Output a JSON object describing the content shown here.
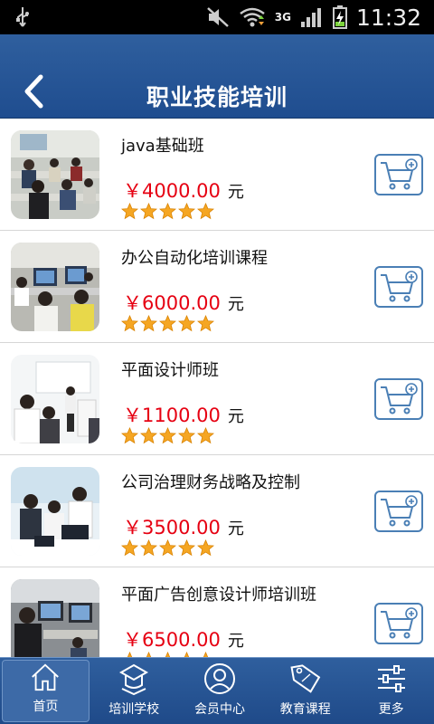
{
  "status": {
    "time": "11:32",
    "network": "3G"
  },
  "header": {
    "title": "职业技能培训"
  },
  "courses": [
    {
      "name": "java基础班",
      "price": "￥4000.00",
      "unit": "元",
      "rating": 5
    },
    {
      "name": "办公自动化培训课程",
      "price": "￥6000.00",
      "unit": "元",
      "rating": 5
    },
    {
      "name": "平面设计师班",
      "price": "￥1100.00",
      "unit": "元",
      "rating": 5
    },
    {
      "name": "公司治理财务战略及控制",
      "price": "￥3500.00",
      "unit": "元",
      "rating": 5
    },
    {
      "name": "平面广告创意设计师培训班",
      "price": "￥6500.00",
      "unit": "元",
      "rating": 5
    }
  ],
  "nav": {
    "items": [
      {
        "label": "首页",
        "icon": "home-icon",
        "active": true
      },
      {
        "label": "培训学校",
        "icon": "school-icon",
        "active": false
      },
      {
        "label": "会员中心",
        "icon": "user-icon",
        "active": false
      },
      {
        "label": "教育课程",
        "icon": "sale-tag-icon",
        "active": false
      },
      {
        "label": "更多",
        "icon": "settings-sliders-icon",
        "active": false
      }
    ]
  },
  "colors": {
    "header_bg": "#2a5797",
    "price": "#e60012",
    "cart_border": "#4a7fb5",
    "star": "#f5a623"
  }
}
